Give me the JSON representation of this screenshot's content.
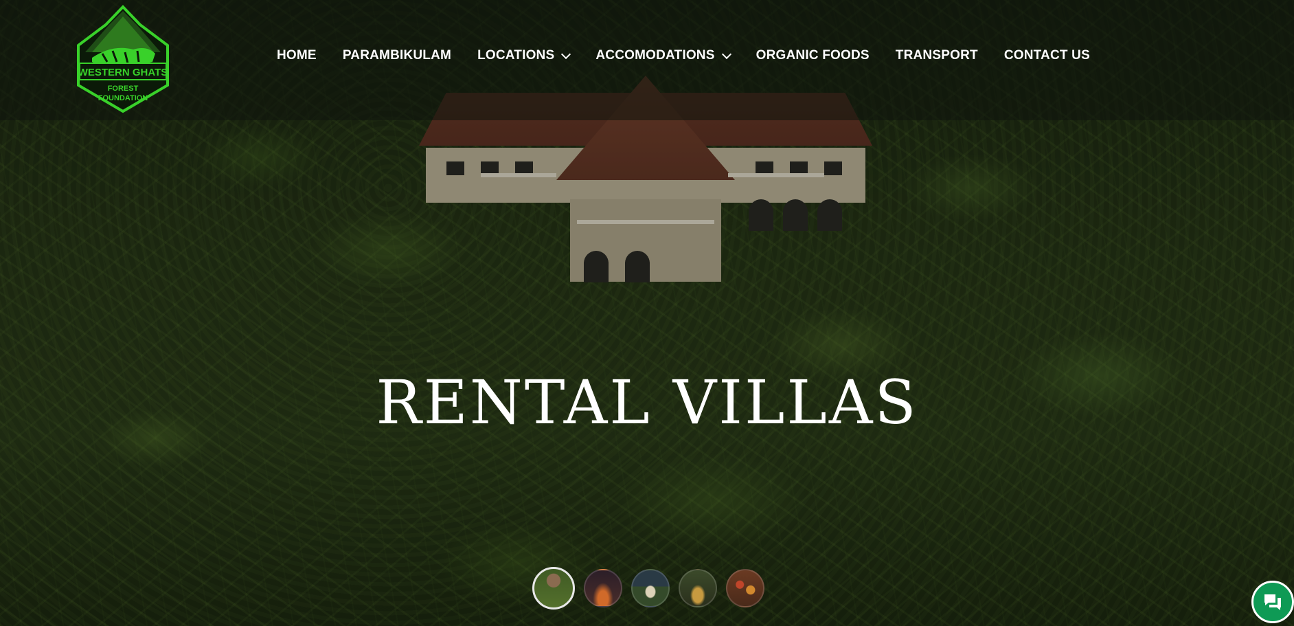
{
  "logo": {
    "line1": "WESTERN GHATS",
    "line2": "FOREST",
    "line3": "FOUNDATION",
    "icon": "tiger-mountain-logo"
  },
  "nav": {
    "items": [
      {
        "label": "HOME",
        "has_dropdown": false
      },
      {
        "label": "PARAMBIKULAM",
        "has_dropdown": false
      },
      {
        "label": "LOCATIONS",
        "has_dropdown": true
      },
      {
        "label": "ACCOMODATIONS",
        "has_dropdown": true
      },
      {
        "label": "ORGANIC FOODS",
        "has_dropdown": false
      },
      {
        "label": "TRANSPORT",
        "has_dropdown": false
      },
      {
        "label": "CONTACT US",
        "has_dropdown": false
      }
    ]
  },
  "hero": {
    "title": "RENTAL VILLAS"
  },
  "slider": {
    "active_index": 0,
    "count": 5
  },
  "chat": {
    "icon": "chat-bubbles-icon"
  },
  "colors": {
    "logo_green": "#39d12a",
    "chat_green": "#0e9a55",
    "nav_text": "#ffffff"
  }
}
